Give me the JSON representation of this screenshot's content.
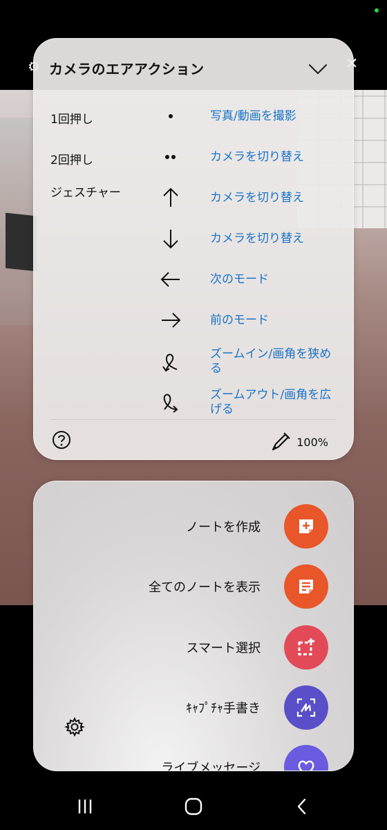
{
  "air_action": {
    "title": "カメラのエアアクション",
    "rows": [
      {
        "label": "1回押し",
        "icon": "single-dot-icon",
        "action": "写真/動画を撮影"
      },
      {
        "label": "2回押し",
        "icon": "double-dot-icon",
        "action": "カメラを切り替え"
      },
      {
        "label": "ジェスチャー",
        "icon": "arrow-up-icon",
        "action": "カメラを切り替え"
      },
      {
        "label": "",
        "icon": "arrow-down-icon",
        "action": "カメラを切り替え"
      },
      {
        "label": "",
        "icon": "arrow-left-icon",
        "action": "次のモード"
      },
      {
        "label": "",
        "icon": "arrow-right-icon",
        "action": "前のモード"
      },
      {
        "label": "",
        "icon": "loop-ccw-icon",
        "action": "ズームイン/画角を狭める"
      },
      {
        "label": "",
        "icon": "loop-cw-icon",
        "action": "ズームアウト/画角を広げる"
      }
    ],
    "battery": "100%"
  },
  "pen_menu": {
    "items": [
      {
        "label": "ノートを作成",
        "icon": "create-note-icon",
        "color": "#e8562a"
      },
      {
        "label": "全てのノートを表示",
        "icon": "view-notes-icon",
        "color": "#e8562a"
      },
      {
        "label": "スマート選択",
        "icon": "smart-select-icon",
        "color": "#e24a58"
      },
      {
        "label": "ｷｬﾌﾟﾁｬ手書き",
        "icon": "screen-write-icon",
        "color": "#5a4fc8"
      },
      {
        "label": "ライブメッセージ",
        "icon": "live-message-icon",
        "color": "#6a5be0"
      }
    ]
  },
  "colors": {
    "accent_text": "#1a73c8",
    "panel_bg": "#ece9e8"
  }
}
